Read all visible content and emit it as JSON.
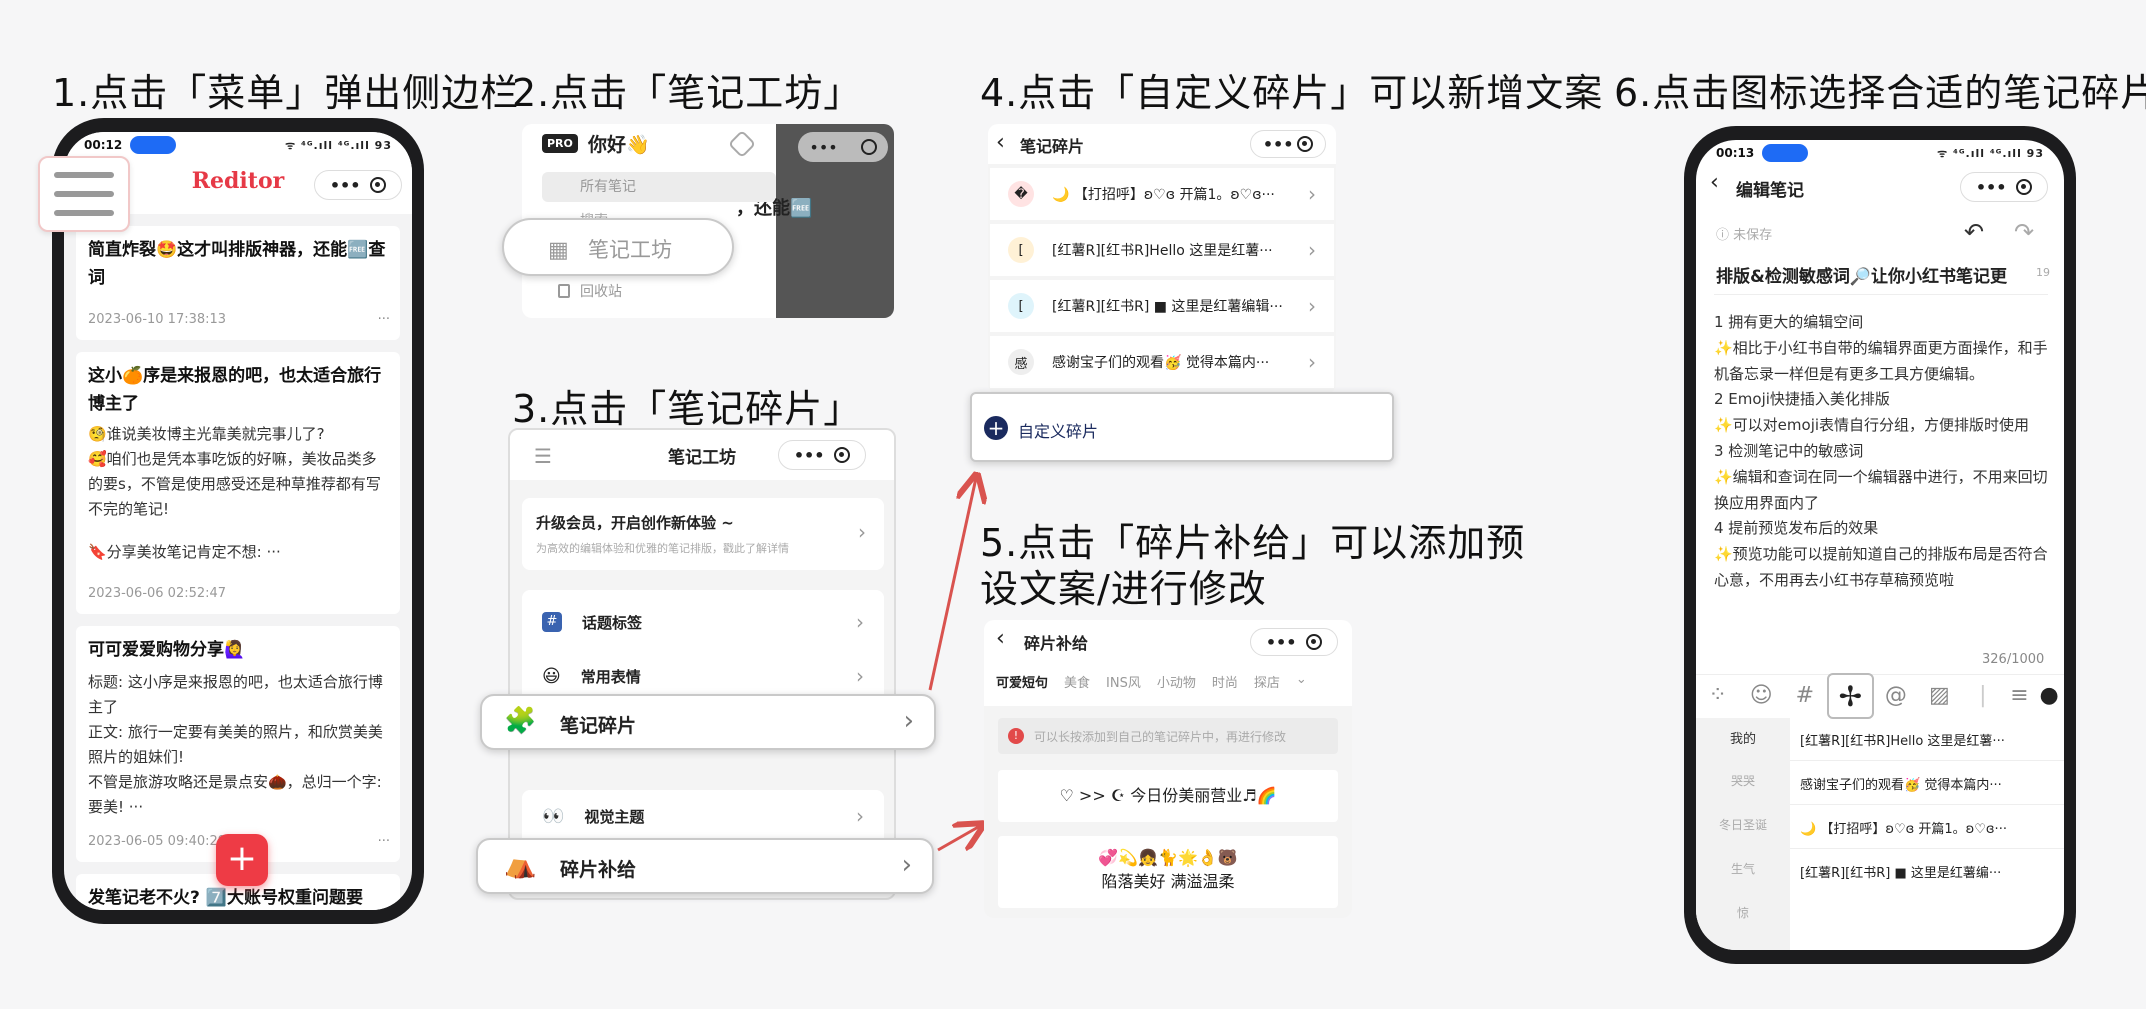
{
  "steps": {
    "s1": "1.点击「菜单」弹出侧边栏",
    "s2": "2.点击「笔记工坊」",
    "s3": "3.点击「笔记碎片」",
    "s4": "4.点击「自定义碎片」可以新增文案",
    "s5": "5.点击「碎片补给」可以添加预设文案/进行修改",
    "s6": "6.点击图标选择合适的笔记碎片"
  },
  "phone1": {
    "time": "00:12",
    "app_title": "Reditor",
    "status_icons": "ᯤ ⁴ᴳ.ıll ⁴ᴳ.ıll 93",
    "posts": [
      {
        "title": "简直炸裂🤩这才叫排版神器，还能🆓查词",
        "date": "2023-06-10 17:38:13"
      },
      {
        "title": "这小🍊序是来报恩的吧，也太适合旅行博主了",
        "body": [
          "🧐谁说美妆博主光靠美就完事儿了?",
          "🥰咱们也是凭本事吃饭的好嘛，美妆品类多的要s，不管是使用感受还是种草推荐都有写不完的笔记!"
        ],
        "extra": "🔖分享美妆笔记肯定不想: ···",
        "date": "2023-06-06 02:52:47"
      },
      {
        "title": "可可爱爱购物分享🙋‍♀️",
        "body": [
          "标题: 这小序是来报恩的吧，也太适合旅行博主了",
          "正文: 旅行一定要有美美的照片，和欣赏美美照片的姐妹们!",
          "不管是旅游攻略还是景点安🌰，总归一个字: 要美! ···"
        ],
        "date": "2023-06-05 09:40:29"
      },
      {
        "title": "发笔记老不火? 7️⃣大账号权重问题要"
      }
    ],
    "more": "···",
    "fab": "+"
  },
  "panel2": {
    "pro": "PRO",
    "greeting": "你好👋",
    "all_notes": "所有笔记",
    "search": "搜索",
    "workshop": "笔记工坊",
    "recycle": "回收站",
    "bg_text": "，还能🆓"
  },
  "panel3": {
    "title": "笔记工坊",
    "promo_title": "升级会员，开启创作新体验 ~",
    "promo_sub": "为高效的编辑体验和优雅的笔记排版，戳此了解详情",
    "items": [
      "话题标签",
      "常用表情",
      "笔记碎片",
      "视觉主题",
      "碎片补给"
    ],
    "icons": [
      "#",
      "😃",
      "🧩",
      "👀",
      "⛺"
    ]
  },
  "panel4": {
    "title": "笔记碎片",
    "rows": [
      {
        "icon": "�",
        "text": "🌙 【打招呼】ʚ♡ɞ 开篇1。ʚ♡ɞ···"
      },
      {
        "icon": "[",
        "text": "[红薯R][红书R]Hello 这里是红薯···"
      },
      {
        "icon": "[",
        "text": "[红薯R][红书R] ■ 这里是红薯编辑···"
      },
      {
        "icon": "感",
        "text": "感谢宝子们的观看🥳 觉得本篇内···"
      }
    ],
    "custom": "自定义碎片"
  },
  "panel5": {
    "title": "碎片补给",
    "tabs": [
      "可爱短句",
      "美食",
      "INS风",
      "小动物",
      "时尚",
      "探店"
    ],
    "tip": "可以长按添加到自己的笔记碎片中，再进行修改",
    "cards": [
      "♡ >> ☪ 今日份美丽营业♬🌈",
      "💞💫👧🐈🌟👌🐻",
      "陷落美好 满溢温柔"
    ]
  },
  "phone6": {
    "time": "00:13",
    "title": "编辑笔记",
    "unsaved": "未保存",
    "note_title": "排版&检测敏感词🔎让你小红书笔记更",
    "title_count": "19",
    "lines": [
      "1 拥有更大的编辑空间",
      "✨相比于小红书自带的编辑界面更方面操作，和手机备忘录一样但是有更多工具方便编辑。",
      "2 Emoji快捷插入美化排版",
      "✨可以对emoji表情自行分组，方便排版时使用",
      "3 检测笔记中的敏感词",
      "✨编辑和查词在同一个编辑器中进行，不用来回切换应用界面内了",
      "4 提前预览发布后的效果",
      "✨预览功能可以提前知道自己的排版布局是否符合心意，不用再去小红书存草稿预览啦"
    ],
    "count": "326/1000",
    "categories": [
      "我的",
      "哭哭",
      "冬日圣诞",
      "生气",
      "惊"
    ],
    "snippets": [
      "[红薯R][红书R]Hello 这里是红薯···",
      "感谢宝子们的观看🥳 觉得本篇内···",
      "🌙 【打招呼】ʚ♡ɞ 开篇1。ʚ♡ɞ···",
      "[红薯R][红书R] ■ 这里是红薯编···"
    ]
  }
}
